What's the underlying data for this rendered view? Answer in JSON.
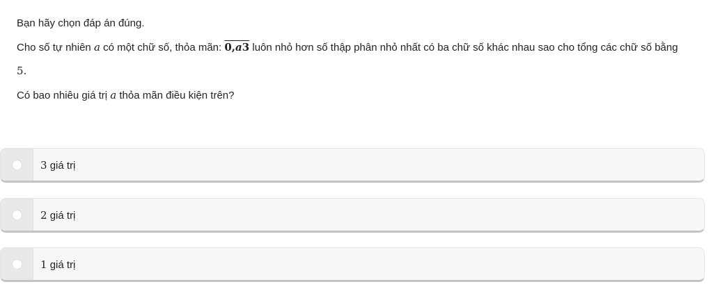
{
  "question": {
    "instruction": "Bạn hãy chọn đáp án đúng.",
    "line1_part1": "Cho số tự nhiên ",
    "var_a": "a",
    "line1_part2": " có một chữ số, thỏa mãn: ",
    "overline_prefix": "0,",
    "overline_var": "a",
    "overline_suffix": "3",
    "line1_part3": " luôn nhỏ hơn số thập phân nhỏ nhất có ba chữ số khác nhau sao cho tổng các chữ số bằng",
    "line2": "5.",
    "line3_part1": "Có bao nhiêu giá trị ",
    "line3_var": "a",
    "line3_part2": " thỏa mãn điều kiện trên?"
  },
  "options": [
    {
      "number": "3",
      "text": " giá trị"
    },
    {
      "number": "2",
      "text": " giá trị"
    },
    {
      "number": "1",
      "text": " giá trị"
    }
  ]
}
